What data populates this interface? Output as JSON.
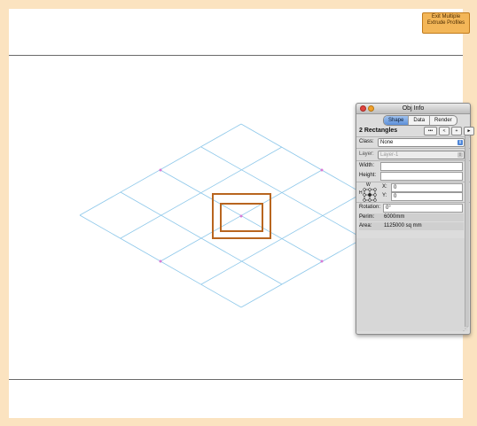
{
  "toolbar": {
    "exit_label": "Exit Multiple Extrude Profiles"
  },
  "colors": {
    "frame": "#fbe3c0",
    "grid": "#8ec8ea",
    "selection": "#b8651f",
    "marker": "#d77ad6"
  },
  "palette": {
    "title": "Obj Info",
    "tabs": [
      {
        "label": "Shape",
        "active": true
      },
      {
        "label": "Data",
        "active": false
      },
      {
        "label": "Render",
        "active": false
      }
    ],
    "selection_title": "2 Rectangles",
    "nav": {
      "more": "•••",
      "prev": "<",
      "add": "+",
      "next": "►"
    },
    "class_label": "Class:",
    "class_value": "None",
    "layer_label": "Layer:",
    "layer_value": "Layer-1",
    "width_label": "Width:",
    "width_value": "",
    "height_label": "Height:",
    "height_value": "",
    "anchor_w_label": "W",
    "anchor_h_label": "H",
    "x_label": "X:",
    "x_value": "0",
    "y_label": "Y:",
    "y_value": "0",
    "rotation_label": "Rotation:",
    "rotation_value": "0°",
    "perim_label": "Perim:",
    "perim_value": "6000mm",
    "area_label": "Area:",
    "area_value": "1125000 sq mm"
  }
}
